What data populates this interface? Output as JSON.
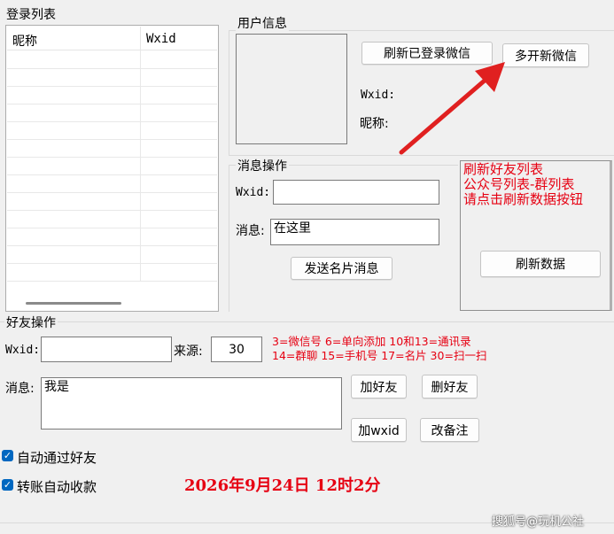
{
  "login_list": {
    "title": "登录列表",
    "columns": [
      "昵称",
      "Wxid"
    ],
    "rows": []
  },
  "user_info": {
    "title": "用户信息",
    "refresh_button": "刷新已登录微信",
    "multi_open_button": "多开新微信",
    "wxid_label": "Wxid:",
    "nickname_label": "昵称:"
  },
  "message_ops": {
    "title": "消息操作",
    "wxid_label": "Wxid:",
    "wxid_value": "",
    "message_label": "消息:",
    "message_value": "在这里",
    "send_card_button": "发送名片消息"
  },
  "refresh_panel": {
    "notice_lines": [
      "刷新好友列表",
      "公众号列表-群列表",
      "请点击刷新数据按钮"
    ],
    "refresh_button": "刷新数据"
  },
  "friend_ops": {
    "title": "好友操作",
    "wxid_label": "Wxid:",
    "wxid_value": "",
    "source_label": "来源:",
    "source_value": "30",
    "source_hint_lines": [
      "3=微信号 6=单向添加 10和13=通讯录",
      "14=群聊 15=手机号 17=名片 30=扫一扫"
    ],
    "message_label": "消息:",
    "message_value": "我是",
    "add_friend_button": "加好友",
    "delete_friend_button": "删好友",
    "add_wxid_button": "加wxid",
    "edit_remark_button": "改备注"
  },
  "options": {
    "auto_accept_label": "自动通过好友",
    "auto_accept_checked": true,
    "auto_collect_label": "转账自动收款",
    "auto_collect_checked": true
  },
  "timestamp": "2026年9月24日 12时2分",
  "watermark": "搜狐号@玩机公社",
  "colors": {
    "accent": "#0067c0",
    "annotation_red": "#e60012",
    "arrow_red": "#e02020"
  }
}
